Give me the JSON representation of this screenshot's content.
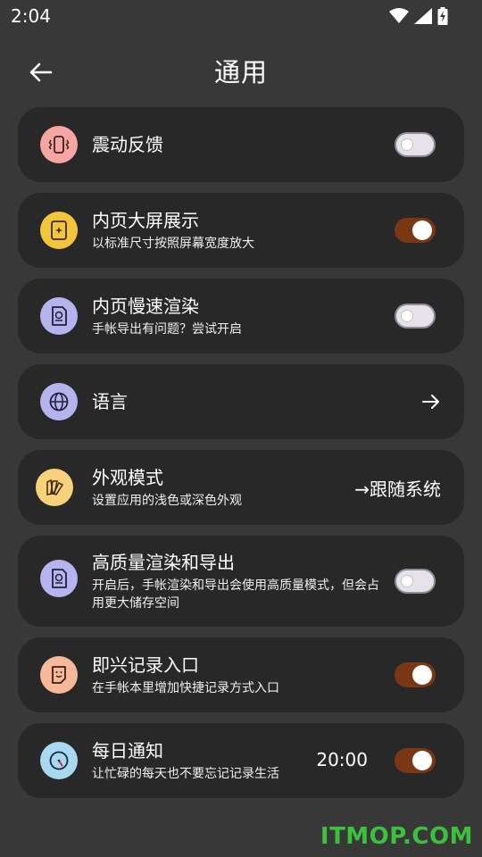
{
  "status_bar": {
    "time": "2:04",
    "icons": [
      "wifi-icon",
      "signal-icon",
      "battery-charging-icon"
    ]
  },
  "header": {
    "title": "通用",
    "back_icon": "arrow-left-icon"
  },
  "settings": [
    {
      "title": "震动反馈",
      "subtitle": "",
      "control": "toggle",
      "on": false,
      "icon": "vibration-icon",
      "icon_bg": "#f5a5a2"
    },
    {
      "title": "内页大屏展示",
      "subtitle": "以标准尺寸按照屏幕宽度放大",
      "control": "toggle",
      "on": true,
      "icon": "tablet-icon",
      "icon_bg": "#f3c53a"
    },
    {
      "title": "内页慢速渲染",
      "subtitle": "手帐导出有问题？尝试开启",
      "control": "toggle",
      "on": false,
      "icon": "document-icon",
      "icon_bg": "#b6b4ee"
    },
    {
      "title": "语言",
      "subtitle": "",
      "control": "arrow",
      "icon": "globe-icon",
      "icon_bg": "#b6b4ee"
    },
    {
      "title": "外观模式",
      "subtitle": "设置应用的浅色或深色外观",
      "control": "value",
      "value": "→跟随系统",
      "icon": "palette-icon",
      "icon_bg": "#f7d27a"
    },
    {
      "title": "高质量渲染和导出",
      "subtitle": "开启后，手帐渲染和导出会使用高质量模式，但会占用更大储存空间",
      "control": "toggle",
      "on": false,
      "icon": "document-icon",
      "icon_bg": "#b6b4ee"
    },
    {
      "title": "即兴记录入口",
      "subtitle": "在手帐本里增加快捷记录方式入口",
      "control": "toggle",
      "on": true,
      "icon": "note-icon",
      "icon_bg": "#f6b899"
    },
    {
      "title": "每日通知",
      "subtitle": "让忙碌的每天也不要忘记记录生活",
      "control": "toggle_time",
      "on": true,
      "time": "20:00",
      "icon": "clock-icon",
      "icon_bg": "#a9d9f2"
    }
  ],
  "watermark": "ITMOP.COM",
  "colors": {
    "background": "#383838",
    "card": "#282828",
    "toggle_on": "#7a3714",
    "toggle_off": "#e6e2ea",
    "watermark": "#3cc13c"
  }
}
